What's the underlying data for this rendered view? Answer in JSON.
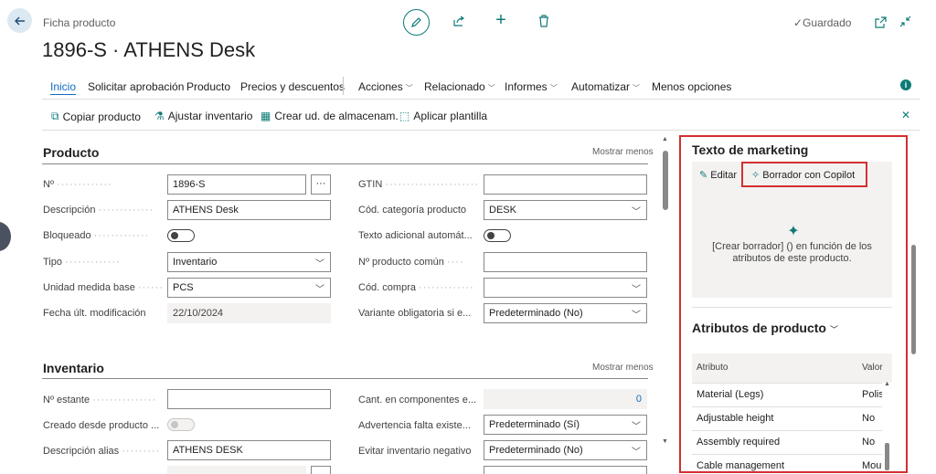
{
  "header": {
    "breadcrumb": "Ficha producto",
    "title": "1896-S · ATHENS Desk",
    "saved_status": "✓Guardado"
  },
  "action_bar": {
    "tabs": [
      {
        "label": "Inicio",
        "active": true
      },
      {
        "label": "Solicitar aprobación"
      },
      {
        "label": "Producto"
      },
      {
        "label": "Precios y descuentos"
      }
    ],
    "menus": [
      {
        "label": "Acciones"
      },
      {
        "label": "Relacionado"
      },
      {
        "label": "Informes"
      },
      {
        "label": "Automatizar"
      }
    ],
    "less_options": "Menos opciones"
  },
  "sub_actions": [
    {
      "label": "Copiar producto",
      "icon": "copy-icon"
    },
    {
      "label": "Ajustar inventario",
      "icon": "adjust-inventory-icon"
    },
    {
      "label": "Crear ud. de almacenam.",
      "icon": "stockkeeping-icon"
    },
    {
      "label": "Aplicar plantilla",
      "icon": "template-icon"
    }
  ],
  "product_section": {
    "title": "Producto",
    "show_less": "Mostrar menos",
    "left_fields": [
      {
        "label": "Nº",
        "value": "1896-S"
      },
      {
        "label": "Descripción",
        "value": "ATHENS Desk"
      },
      {
        "label": "Bloqueado",
        "value": ""
      },
      {
        "label": "Tipo",
        "value": "Inventario"
      },
      {
        "label": "Unidad medida base",
        "value": "PCS"
      },
      {
        "label": "Fecha últ. modificación",
        "value": "22/10/2024"
      }
    ],
    "right_fields": [
      {
        "label": "GTIN",
        "value": ""
      },
      {
        "label": "Cód. categoría producto",
        "value": "DESK"
      },
      {
        "label": "Texto adicional automát...",
        "value": ""
      },
      {
        "label": "Nº producto común",
        "value": ""
      },
      {
        "label": "Cód. compra",
        "value": ""
      },
      {
        "label": "Variante obligatoria si e...",
        "value": "Predeterminado (No)"
      }
    ],
    "assist_label": "···"
  },
  "inventory_section": {
    "title": "Inventario",
    "show_less": "Mostrar menos",
    "left_fields": [
      {
        "label": "Nº estante",
        "value": ""
      },
      {
        "label": "Creado desde producto ...",
        "value": ""
      },
      {
        "label": "Descripción alias",
        "value": "ATHENS DESK"
      }
    ],
    "right_fields": [
      {
        "label": "Cant. en componentes e...",
        "value": "0"
      },
      {
        "label": "Advertencia falta existe...",
        "value": "Predeterminado (Sí)"
      },
      {
        "label": "Evitar inventario negativo",
        "value": "Predeterminado (No)"
      }
    ]
  },
  "factbox": {
    "marketing_title": "Texto de marketing",
    "edit_label": "Editar",
    "copilot_label": "Borrador con Copilot",
    "copilot_text": "[Crear borrador] () en función de los atributos de este producto.",
    "attributes_title": "Atributos de producto",
    "attr_headers": [
      "Atributo",
      "Valor"
    ],
    "attributes": [
      {
        "name": "Material (Legs)",
        "value": "Polish"
      },
      {
        "name": "Adjustable height",
        "value": "No"
      },
      {
        "name": "Assembly required",
        "value": "No"
      },
      {
        "name": "Cable management",
        "value": "Mou"
      }
    ]
  },
  "colors": {
    "accent": "#0f7b78",
    "link": "#0f6cbd",
    "highlight_border": "#d32f2f"
  }
}
